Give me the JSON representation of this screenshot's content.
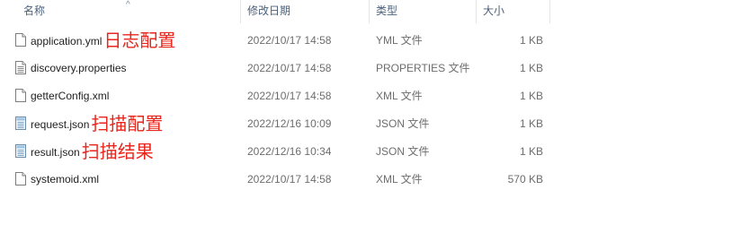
{
  "columns": {
    "name": "名称",
    "date": "修改日期",
    "type": "类型",
    "size": "大小"
  },
  "sort_indicator": "^",
  "files": [
    {
      "name": "application.yml",
      "annotation": "日志配置",
      "date": "2022/10/17 14:58",
      "type": "YML 文件",
      "size": "1 KB",
      "icon": "document-icon"
    },
    {
      "name": "discovery.properties",
      "annotation": "",
      "date": "2022/10/17 14:58",
      "type": "PROPERTIES 文件",
      "size": "1 KB",
      "icon": "text-document-icon"
    },
    {
      "name": "getterConfig.xml",
      "annotation": "",
      "date": "2022/10/17 14:58",
      "type": "XML 文件",
      "size": "1 KB",
      "icon": "document-icon"
    },
    {
      "name": "request.json",
      "annotation": "扫描配置",
      "date": "2022/12/16 10:09",
      "type": "JSON 文件",
      "size": "1 KB",
      "icon": "json-file-icon"
    },
    {
      "name": "result.json",
      "annotation": "扫描结果",
      "date": "2022/12/16 10:34",
      "type": "JSON 文件",
      "size": "1 KB",
      "icon": "json-file-icon"
    },
    {
      "name": "systemoid.xml",
      "annotation": "",
      "date": "2022/10/17 14:58",
      "type": "XML 文件",
      "size": "570 KB",
      "icon": "document-icon"
    }
  ]
}
